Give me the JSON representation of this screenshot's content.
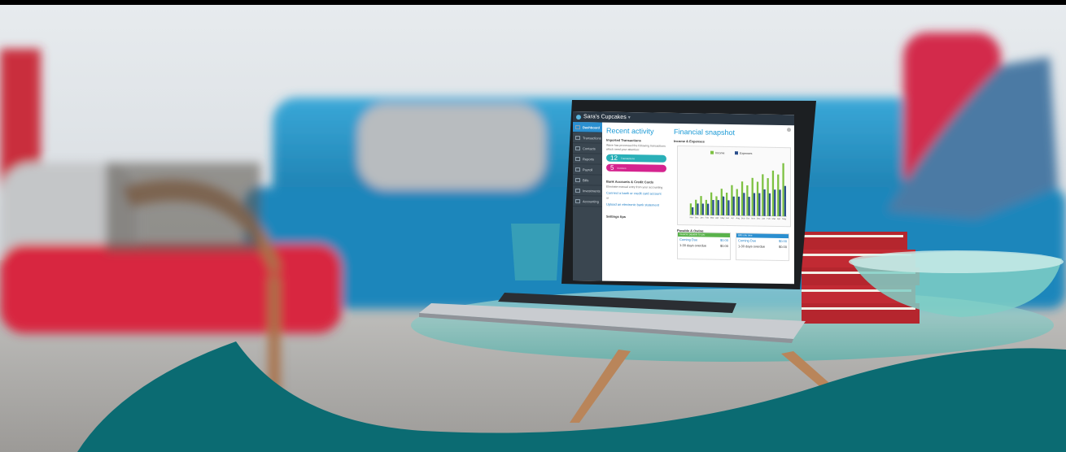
{
  "app": {
    "company_name": "Sara's Cupcakes",
    "nav": [
      "Dashboard",
      "Transactions",
      "Contacts",
      "Reports",
      "Payroll",
      "Bills",
      "Investments",
      "Accounting"
    ]
  },
  "recent_activity": {
    "title": "Recent activity",
    "imported_heading": "Imported Transactions",
    "imported_text": "Wave has processed the following transactions which need your attention:",
    "pill_teal_count": "12",
    "pill_teal_label": "Transactions",
    "pill_pink_count": "5",
    "pill_pink_label": "Invoices",
    "bank_heading": "Bank Accounts & Credit Cards",
    "bank_text": "Eliminate manual entry from your accounting",
    "connect_link": "Connect a bank or credit card account",
    "or_text": "or",
    "upload_link": "Upload an electronic bank statement",
    "tips_heading": "Settings tips"
  },
  "snapshot": {
    "title": "Financial snapshot",
    "chart_heading": "Income & Expenses",
    "payable_heading": "Payable & Owing",
    "invoices_header": "Invoices payable to you",
    "bills_header": "Bills you owe",
    "coming_due": "Coming Due",
    "coming_due_value": "$0.00",
    "overdue_label": "1-30 days overdue",
    "overdue_value": "$0.00"
  },
  "chart_data": {
    "type": "bar",
    "categories": [
      "Nov",
      "Dec",
      "Jan",
      "Feb",
      "Mar",
      "Apr",
      "May",
      "Jun",
      "Jul",
      "Aug",
      "Sep",
      "Oct",
      "Nov",
      "Dec",
      "Jan",
      "Feb",
      "Mar",
      "Apr",
      "May"
    ],
    "series": [
      {
        "name": "Income",
        "values": [
          3,
          4,
          5,
          4,
          6,
          5,
          7,
          6,
          8,
          7,
          9,
          8,
          10,
          9,
          11,
          10,
          12,
          11,
          14
        ],
        "color": "#7dc142"
      },
      {
        "name": "Expenses",
        "values": [
          2,
          3,
          3,
          3,
          4,
          4,
          5,
          4,
          5,
          5,
          6,
          5,
          6,
          6,
          7,
          6,
          7,
          7,
          8
        ],
        "color": "#2a4f8c"
      }
    ],
    "ylim": [
      0,
      15
    ]
  },
  "colors": {
    "teal": "#0b6b72",
    "sofa": "#1e8fc0",
    "chair_cushion": "#d8283f",
    "accent_blue": "#1b9ad6"
  }
}
